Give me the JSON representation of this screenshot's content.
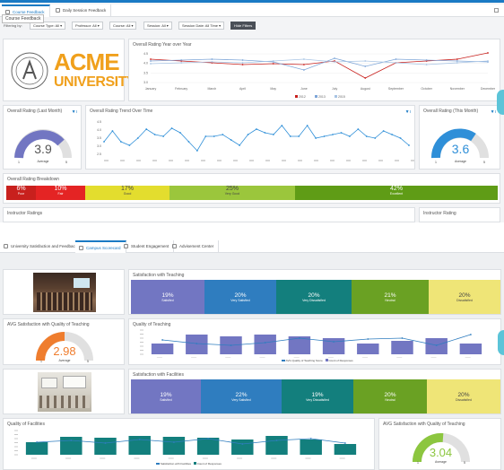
{
  "top": {
    "tabs": [
      {
        "label": "Course Feedback"
      },
      {
        "label": "Daily Session Feedback"
      }
    ],
    "tooltip": "Course Feedback",
    "filter_label": "Filtering by:",
    "filters": [
      "Course Type: All",
      "Professor: All",
      "Course: All",
      "Session: All",
      "Session Date: All Time"
    ],
    "hide_filters": "Hide Filters",
    "logo": {
      "line1": "ACME",
      "line2": "UNIVERSITY"
    },
    "yoy": {
      "title": "Overall Rating Year over Year",
      "months": [
        "January",
        "February",
        "March",
        "April",
        "May",
        "June",
        "July",
        "August",
        "September",
        "October",
        "November",
        "December"
      ],
      "yticks": [
        "4.5",
        "4.0",
        "3.5",
        "3.0"
      ],
      "legend": [
        "2012",
        "2013",
        "2015"
      ]
    },
    "last_month": {
      "title": "Overall Rating (Last Month)",
      "value": "3.9",
      "label": "Average",
      "min": "1",
      "max": "5"
    },
    "trend": {
      "title": "Overall Rating Trend Over Time",
      "yticks": [
        "4.5",
        "4.0",
        "3.5",
        "3.0",
        "2.5"
      ]
    },
    "this_month": {
      "title": "Overall Rating (This Month)",
      "value": "3.6",
      "label": "Average",
      "min": "1",
      "max": "5"
    },
    "breakdown": {
      "title": "Overall Rating Breakdown",
      "segments": [
        {
          "pct": "6%",
          "label": "Poor"
        },
        {
          "pct": "10%",
          "label": "Fair"
        },
        {
          "pct": "17%",
          "label": "Good"
        },
        {
          "pct": "25%",
          "label": "Very Good"
        },
        {
          "pct": "42%",
          "label": "Excellent"
        }
      ]
    },
    "instructor_ratings": "Instructor Ratings",
    "instructor_rating": "Instructor Rating"
  },
  "bottom": {
    "tabs": [
      {
        "label": "University Satisfaction and Feedback"
      },
      {
        "label": "Campus Scorecard"
      },
      {
        "label": "Student Engagement"
      },
      {
        "label": "Advisement Center"
      }
    ],
    "sat_teaching": {
      "title": "Satisfaction with Teaching",
      "segments": [
        {
          "pct": "19%",
          "label": "Satisfied"
        },
        {
          "pct": "20%",
          "label": "Very Satisfied"
        },
        {
          "pct": "20%",
          "label": "Very Dissatisfied"
        },
        {
          "pct": "21%",
          "label": "Neutral"
        },
        {
          "pct": "20%",
          "label": "Dissatisfied"
        }
      ]
    },
    "avg_teaching": {
      "title": "AVG Satisfaction with Quality of Teaching",
      "value": "2.98",
      "label": "Average",
      "min": "1",
      "max": "5"
    },
    "quality_teaching": {
      "title": "Quality of Teaching",
      "legend": [
        "AVG Quality of Teaching Score",
        "Count of Responses"
      ]
    },
    "sat_facilities": {
      "title": "Satisfaction with Facilities",
      "segments": [
        {
          "pct": "19%",
          "label": "Satisfied"
        },
        {
          "pct": "22%",
          "label": "Very Satisfied"
        },
        {
          "pct": "19%",
          "label": "Very Dissatisfied"
        },
        {
          "pct": "20%",
          "label": "Neutral"
        },
        {
          "pct": "20%",
          "label": "Dissatisfied"
        }
      ]
    },
    "quality_facilities": {
      "title": "Quality of Facilities",
      "legend": [
        "Satisfaction with Facilities",
        "Count of Responses"
      ]
    },
    "avg_facilities": {
      "title": "AVG Satisfaction with Quality of Teaching",
      "value": "3.04",
      "label": "Average",
      "min": "1",
      "max": "5"
    }
  },
  "colors": {
    "accent": "#1a7ac4",
    "purple": "#7276c2",
    "blue": "#2f7dbf",
    "teal": "#137f7d",
    "green": "#6aa123",
    "yellow": "#efe577"
  }
}
